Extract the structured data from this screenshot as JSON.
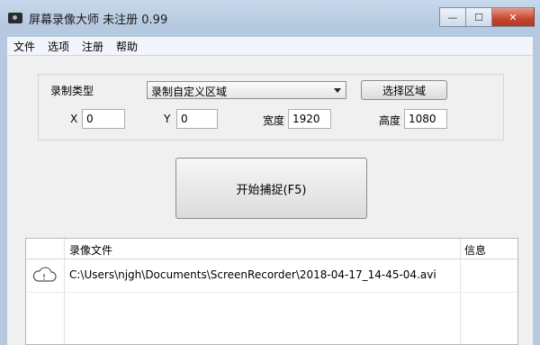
{
  "window": {
    "title": "屏幕录像大师 未注册 0.99"
  },
  "menu": [
    "文件",
    "选项",
    "注册",
    "帮助"
  ],
  "controls": {
    "record_type_label": "录制类型",
    "record_type_value": "录制自定义区域",
    "select_area_button": "选择区域",
    "x_label": "X",
    "x_value": "0",
    "y_label": "Y",
    "y_value": "0",
    "width_label": "宽度",
    "width_value": "1920",
    "height_label": "高度",
    "height_value": "1080",
    "start_button": "开始捕捉(F5)"
  },
  "list": {
    "columns": [
      "录像文件",
      "信息"
    ],
    "rows": [
      {
        "file": "C:\\Users\\njgh\\Documents\\ScreenRecorder\\2018-04-17_14-45-04.avi",
        "info": ""
      }
    ]
  }
}
